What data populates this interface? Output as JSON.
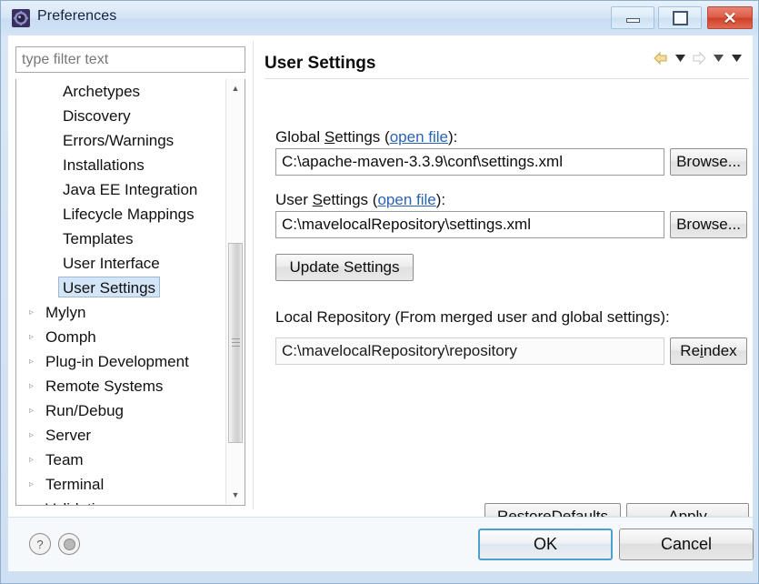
{
  "window": {
    "title": "Preferences",
    "icon": "gear-icon",
    "controls": {
      "minimize": "minimize",
      "maximize": "restore",
      "close": "close"
    }
  },
  "filter": {
    "placeholder": "type filter text",
    "value": ""
  },
  "tree": {
    "items": [
      {
        "label": "Archetypes",
        "level": "child",
        "expandable": false,
        "selected": false
      },
      {
        "label": "Discovery",
        "level": "child",
        "expandable": false,
        "selected": false
      },
      {
        "label": "Errors/Warnings",
        "level": "child",
        "expandable": false,
        "selected": false
      },
      {
        "label": "Installations",
        "level": "child",
        "expandable": false,
        "selected": false
      },
      {
        "label": "Java EE Integration",
        "level": "child",
        "expandable": false,
        "selected": false
      },
      {
        "label": "Lifecycle Mappings",
        "level": "child",
        "expandable": false,
        "selected": false
      },
      {
        "label": "Templates",
        "level": "child",
        "expandable": false,
        "selected": false
      },
      {
        "label": "User Interface",
        "level": "child",
        "expandable": false,
        "selected": false
      },
      {
        "label": "User Settings",
        "level": "child",
        "expandable": false,
        "selected": true
      },
      {
        "label": "Mylyn",
        "level": "parent",
        "expandable": true,
        "selected": false
      },
      {
        "label": "Oomph",
        "level": "parent",
        "expandable": true,
        "selected": false
      },
      {
        "label": "Plug-in Development",
        "level": "parent",
        "expandable": true,
        "selected": false
      },
      {
        "label": "Remote Systems",
        "level": "parent",
        "expandable": true,
        "selected": false
      },
      {
        "label": "Run/Debug",
        "level": "parent",
        "expandable": true,
        "selected": false
      },
      {
        "label": "Server",
        "level": "parent",
        "expandable": true,
        "selected": false
      },
      {
        "label": "Team",
        "level": "parent",
        "expandable": true,
        "selected": false
      },
      {
        "label": "Terminal",
        "level": "parent",
        "expandable": true,
        "selected": false
      },
      {
        "label": "Validation",
        "level": "parent",
        "expandable": true,
        "selected": false
      }
    ],
    "expand_arrow_glyph": "▹",
    "scrollbar": {
      "up_glyph": "▲",
      "down_glyph": "▼"
    }
  },
  "page": {
    "title": "User Settings",
    "nav": {
      "back": "back-arrow",
      "back_menu": "back-dropdown",
      "forward": "forward-arrow",
      "forward_menu": "forward-dropdown",
      "view_menu": "view-menu-dropdown"
    },
    "global_settings": {
      "label_pre": "Global ",
      "label_mnemonic": "S",
      "label_post": "ettings (",
      "link": "open file",
      "label_end": "):",
      "value": "C:\\apache-maven-3.3.9\\conf\\settings.xml",
      "browse": "Browse..."
    },
    "user_settings": {
      "label_pre": "User ",
      "label_mnemonic": "S",
      "label_post": "ettings (",
      "link": "open file",
      "label_end": "):",
      "value": "C:\\mavelocalRepository\\settings.xml",
      "browse": "Browse..."
    },
    "update_button": "Update Settings",
    "local_repository": {
      "label": "Local Repository (From merged user and global settings):",
      "value": "C:\\mavelocalRepository\\repository",
      "button_pre": "Re",
      "button_mnemonic": "i",
      "button_post": "ndex"
    },
    "restore_defaults": {
      "pre": "Restore ",
      "mnemonic": "D",
      "post": "efaults"
    },
    "apply": {
      "pre": "",
      "mnemonic": "A",
      "post": "pply"
    }
  },
  "footer": {
    "help_icon": "?",
    "tip_icon": "tip-icon",
    "ok": "OK",
    "cancel": "Cancel"
  },
  "colors": {
    "accent": "#4ca0cf",
    "link": "#2b63b5",
    "selection": "#d3e5f7",
    "titlebar": "#d4e5f6",
    "close_button": "#cf4028"
  }
}
